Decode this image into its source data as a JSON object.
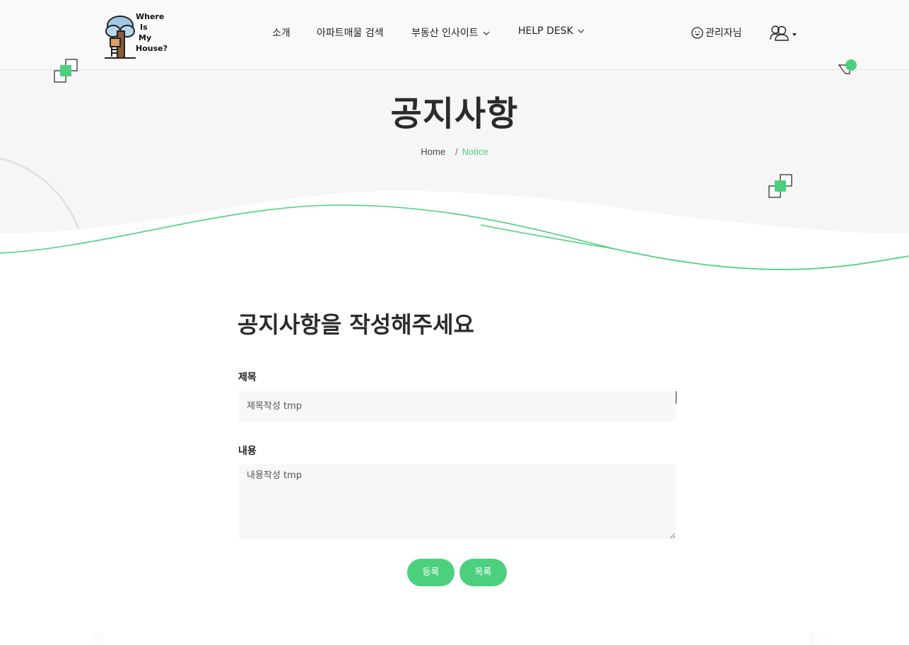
{
  "header": {
    "logo_text": [
      "Where",
      "Is",
      "My",
      "House?"
    ],
    "nav": [
      {
        "label": "소개",
        "has_dropdown": false
      },
      {
        "label": "아파트매물 검색",
        "has_dropdown": false
      },
      {
        "label": "부동산 인사이트",
        "has_dropdown": true
      },
      {
        "label": "HELP DESK",
        "has_dropdown": true
      }
    ],
    "admin_label": "관리자님"
  },
  "hero": {
    "title": "공지사항",
    "breadcrumb": {
      "home": "Home",
      "separator": "/",
      "current": "Notice"
    }
  },
  "form": {
    "heading": "공지사항을 작성해주세요",
    "title_label": "제목",
    "title_value": "제목작성 tmp",
    "content_label": "내용",
    "content_value": "내용작성 tmp",
    "submit_label": "등록",
    "list_label": "목록"
  },
  "colors": {
    "accent": "#4cd07d",
    "hero_bg": "#f6f6f6",
    "input_bg": "#f8f8f8"
  }
}
